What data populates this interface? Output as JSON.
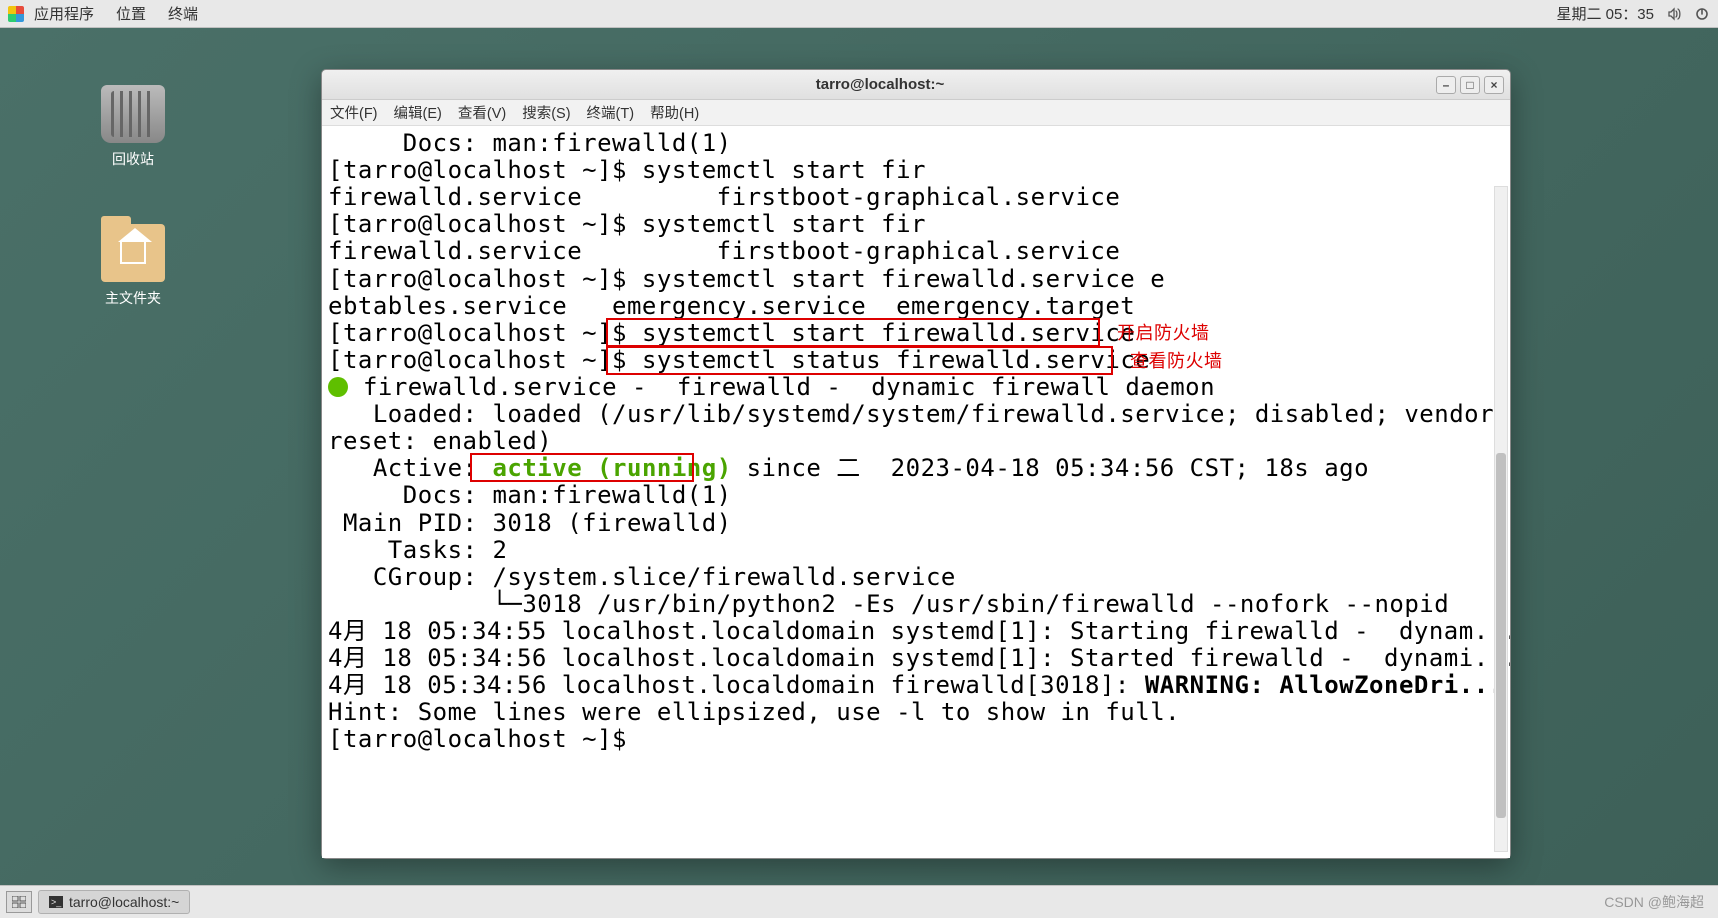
{
  "topbar": {
    "menu_apps": "应用程序",
    "menu_places": "位置",
    "menu_terminal": "终端",
    "clock": "星期二 05：35"
  },
  "desktop": {
    "trash_label": "回收站",
    "home_label": "主文件夹"
  },
  "window": {
    "title": "tarro@localhost:~",
    "menus": {
      "file": "文件(F)",
      "edit": "编辑(E)",
      "view": "查看(V)",
      "search": "搜索(S)",
      "term": "终端(T)",
      "help": "帮助(H)"
    }
  },
  "term": {
    "l1": "     Docs: man:firewalld(1)",
    "l2": "[tarro@localhost ~]$ systemctl start fir",
    "l3": "firewalld.service         firstboot-graphical.service",
    "l4": "[tarro@localhost ~]$ systemctl start fir",
    "l5": "firewalld.service         firstboot-graphical.service",
    "l6": "[tarro@localhost ~]$ systemctl start firewalld.service e",
    "l7": "ebtables.service   emergency.service  emergency.target",
    "l8p": "[tarro@localhost ~]$ ",
    "l8c": "systemctl start firewalld.service ",
    "l9p": "[tarro@localhost ~]$ ",
    "l9c": "systemctl status firewalld.service ",
    "l10": " firewalld.service -  firewalld -  dynamic firewall daemon",
    "l11": "   Loaded: loaded (/usr/lib/systemd/system/firewalld.service; disabled; vendor p",
    "l12": "reset: enabled)",
    "l13a": "   Active: ",
    "l13b": "active (running)",
    "l13c": " since 二  2023-04-18 05:34:56 CST; 18s ago",
    "l14": "     Docs: man:firewalld(1)",
    "l15": " Main PID: 3018 (firewalld)",
    "l16": "    Tasks: 2",
    "l17": "   CGroup: /system.slice/firewalld.service",
    "l18": "           └─3018 /usr/bin/python2 -Es /usr/sbin/firewalld --nofork --nopid",
    "l19": "",
    "l20": "4月 18 05:34:55 localhost.localdomain systemd[1]: Starting firewalld -  dynam...",
    "l21": "4月 18 05:34:56 localhost.localdomain systemd[1]: Started firewalld -  dynami...",
    "l22a": "4月 18 05:34:56 localhost.localdomain firewalld[3018]: ",
    "l22b": "WARNING: AllowZoneDri...",
    "l23": "Hint: Some lines were ellipsized, use -l to show in full.",
    "l24": "[tarro@localhost ~]$ "
  },
  "annotations": {
    "a1": "开启防火墙",
    "a2": "查看防火墙"
  },
  "taskbar": {
    "task1": "tarro@localhost:~"
  },
  "watermark": "CSDN @鲍海超"
}
